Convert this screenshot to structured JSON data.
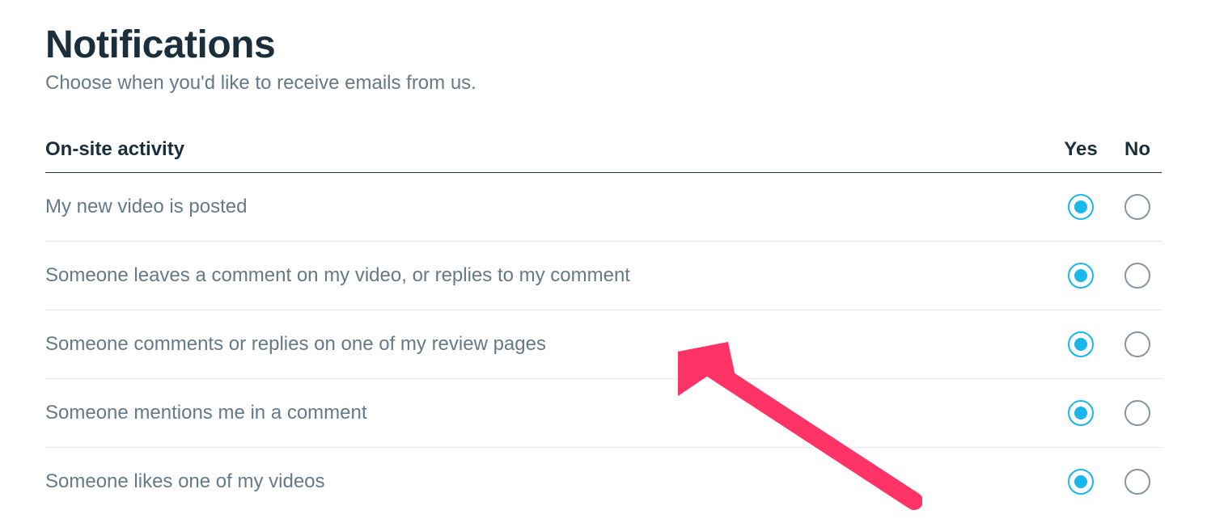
{
  "header": {
    "title": "Notifications",
    "subtitle": "Choose when you'd like to receive emails from us."
  },
  "section": {
    "title": "On-site activity",
    "col_yes": "Yes",
    "col_no": "No"
  },
  "options": [
    {
      "label": "My new video is posted",
      "selected": "yes"
    },
    {
      "label": "Someone leaves a comment on my video, or replies to my comment",
      "selected": "yes"
    },
    {
      "label": "Someone comments or replies on one of my review pages",
      "selected": "yes"
    },
    {
      "label": "Someone mentions me in a comment",
      "selected": "yes"
    },
    {
      "label": "Someone likes one of my videos",
      "selected": "yes"
    }
  ],
  "annotation": {
    "arrow_color": "#ff3366"
  }
}
